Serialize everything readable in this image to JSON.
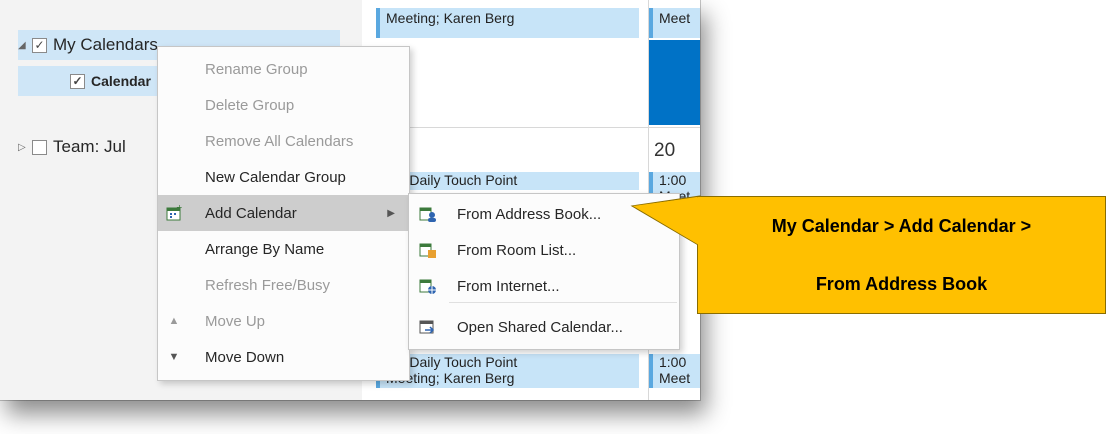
{
  "nav": {
    "my_calendars": "My Calendars",
    "calendar_item": "Calendar",
    "team_item": "Team: Jul"
  },
  "calendar": {
    "appointments": [
      {
        "text1": "Meeting; Karen Berg",
        "text2": ""
      },
      {
        "text1": "Meet",
        "text2": ""
      },
      {
        "text1": "pm Daily Touch Point",
        "text2": ""
      },
      {
        "text1": "1:00",
        "text2": "Meet"
      },
      {
        "text1": "pm Daily Touch Point",
        "text2": "Meeting; Karen Berg"
      },
      {
        "text1": "1:00",
        "text2": "Meet"
      }
    ],
    "day_number": "20"
  },
  "context_menu": {
    "items": [
      {
        "label": "Rename Group",
        "disabled": true
      },
      {
        "label": "Delete Group",
        "disabled": true
      },
      {
        "label": "Remove All Calendars",
        "disabled": true
      },
      {
        "label": "New Calendar Group",
        "disabled": false
      },
      {
        "label": "Add Calendar",
        "disabled": false
      },
      {
        "label": "Arrange By Name",
        "disabled": false
      },
      {
        "label": "Refresh Free/Busy",
        "disabled": true
      },
      {
        "label": "Move Up",
        "disabled": true
      },
      {
        "label": "Move Down",
        "disabled": false
      }
    ]
  },
  "submenu": {
    "items": [
      {
        "label": "From Address Book..."
      },
      {
        "label": "From Room List..."
      },
      {
        "label": "From Internet..."
      },
      {
        "label": "Open Shared Calendar..."
      }
    ]
  },
  "callout": {
    "line1": "My Calendar > Add Calendar >",
    "line2": "From Address Book",
    "color": "#ffc000"
  }
}
